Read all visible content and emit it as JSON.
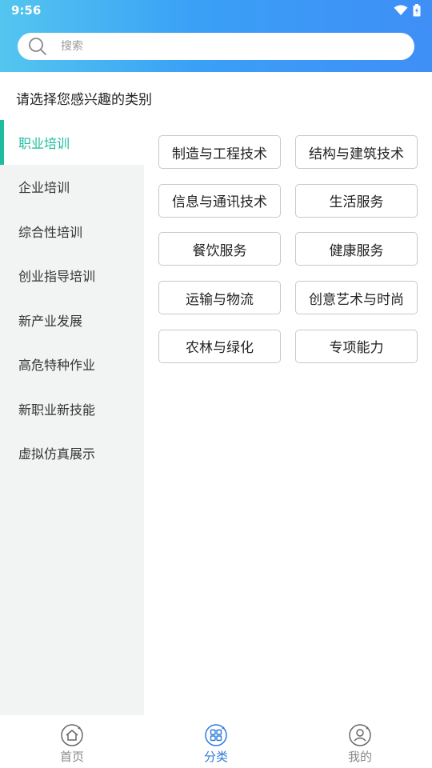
{
  "status_bar": {
    "time": "9:56"
  },
  "search": {
    "placeholder": "搜索"
  },
  "prompt": "请选择您感兴趣的类别",
  "sidebar": {
    "items": [
      {
        "label": "职业培训",
        "active": true
      },
      {
        "label": "企业培训",
        "active": false
      },
      {
        "label": "综合性培训",
        "active": false
      },
      {
        "label": "创业指导培训",
        "active": false
      },
      {
        "label": "新产业发展",
        "active": false
      },
      {
        "label": "高危特种作业",
        "active": false
      },
      {
        "label": "新职业新技能",
        "active": false
      },
      {
        "label": "虚拟仿真展示",
        "active": false
      }
    ]
  },
  "categories": [
    "制造与工程技术",
    "结构与建筑技术",
    "信息与通讯技术",
    "生活服务",
    "餐饮服务",
    "健康服务",
    "运输与物流",
    "创意艺术与时尚",
    "农林与绿化",
    "专项能力"
  ],
  "tabbar": {
    "tabs": [
      {
        "label": "首页",
        "icon": "home-icon"
      },
      {
        "label": "分类",
        "icon": "category-icon",
        "active": true
      },
      {
        "label": "我的",
        "icon": "user-icon"
      }
    ]
  },
  "colors": {
    "accent_green": "#1fbd9e",
    "accent_blue": "#2e7bd9",
    "header_gradient_start": "#53c6ef",
    "header_gradient_end": "#3f8ff6"
  }
}
